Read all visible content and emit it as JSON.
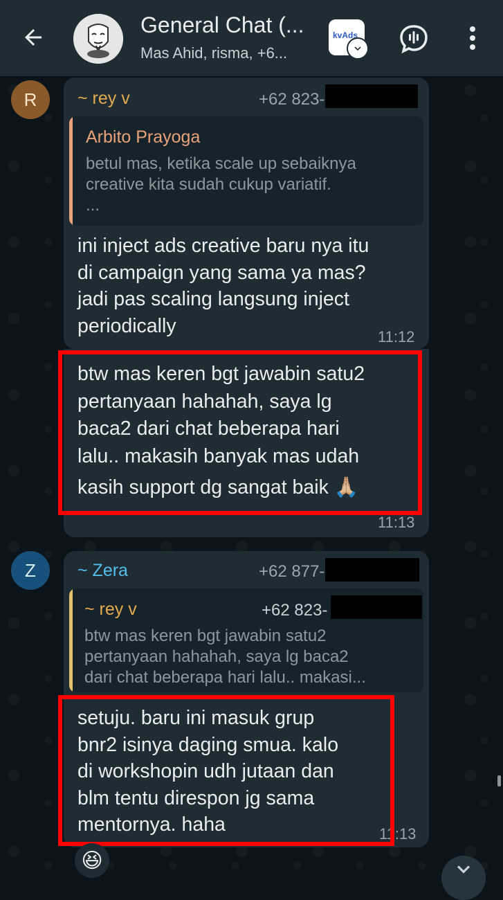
{
  "header": {
    "title": "General Chat (...",
    "subtitle": "Mas Ahid, risma, +6...",
    "app_badge_text": "kvAds"
  },
  "messages": [
    {
      "avatar_letter": "R",
      "sender": "~ rey v",
      "phone": "+62 823-",
      "sender_color": "#e3a94f",
      "quote": {
        "name": "Arbito Prayoga",
        "name_color": "#e9a27a",
        "text_lines": [
          "betul mas, ketika scale up sebaiknya",
          "creative kita sudah cukup variatif.",
          "..."
        ]
      },
      "lines": [
        "ini inject ads creative baru nya itu",
        "di campaign yang sama ya mas?",
        "jadi pas scaling langsung inject",
        "periodically"
      ],
      "time": "11:12"
    },
    {
      "lines": [
        "btw mas keren bgt jawabin satu2",
        "pertanyaan hahahah, saya lg",
        "baca2 dari chat beberapa hari",
        "lalu.. makasih banyak mas udah",
        "kasih support dg sangat baik 🙏🏼"
      ],
      "time": "11:13"
    },
    {
      "avatar_letter": "Z",
      "sender": "~ Zera",
      "phone": "+62 877-",
      "sender_color": "#53bdeb",
      "quote": {
        "name": "~ rey v",
        "phone": "+62 823-",
        "name_color": "#e3a94f",
        "text_lines": [
          "btw mas keren bgt jawabin satu2",
          "pertanyaan hahahah, saya lg baca2",
          "dari chat beberapa hari lalu.. makasi..."
        ]
      },
      "lines": [
        "setuju. baru ini masuk grup",
        "bnr2 isinya daging smua. kalo",
        "di workshopin udh jutaan dan",
        "blm tentu direspon jg sama",
        "mentornya. haha"
      ],
      "time": "11:13",
      "reaction": "😆"
    }
  ],
  "colors": {
    "header_bg": "#1f2c34",
    "bubble_bg": "#1f2c34",
    "highlight": "#ff0000"
  },
  "icons": [
    "back-arrow-icon",
    "voice-chat-icon",
    "more-options-icon",
    "chevron-down-icon"
  ]
}
